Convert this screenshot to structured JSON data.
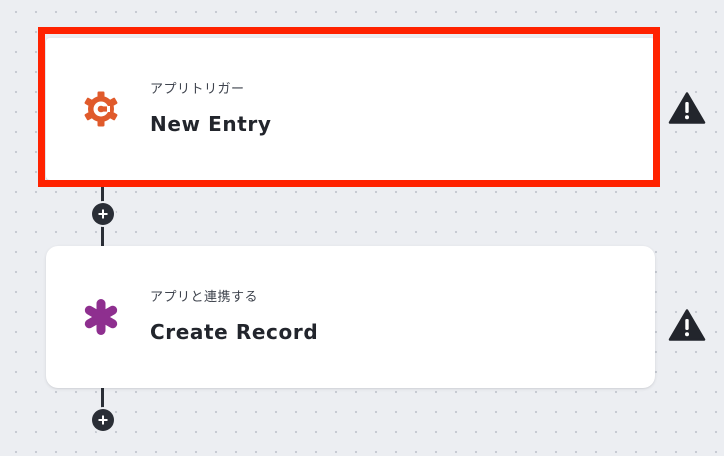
{
  "flow": {
    "steps": [
      {
        "type_label": "アプリトリガー",
        "title": "New Entry",
        "icon": "cog-c-icon",
        "icon_color": "#e05a2b",
        "highlighted": true,
        "warning_icon": "warning-icon"
      },
      {
        "type_label": "アプリと連携する",
        "title": "Create Record",
        "icon": "asterisk-icon",
        "icon_color": "#8e2f8f",
        "highlighted": false,
        "warning_icon": "warning-icon"
      }
    ],
    "add_step_icon": "plus-icon",
    "highlight_color": "#ff2200",
    "connector_color": "#2a2e36"
  }
}
